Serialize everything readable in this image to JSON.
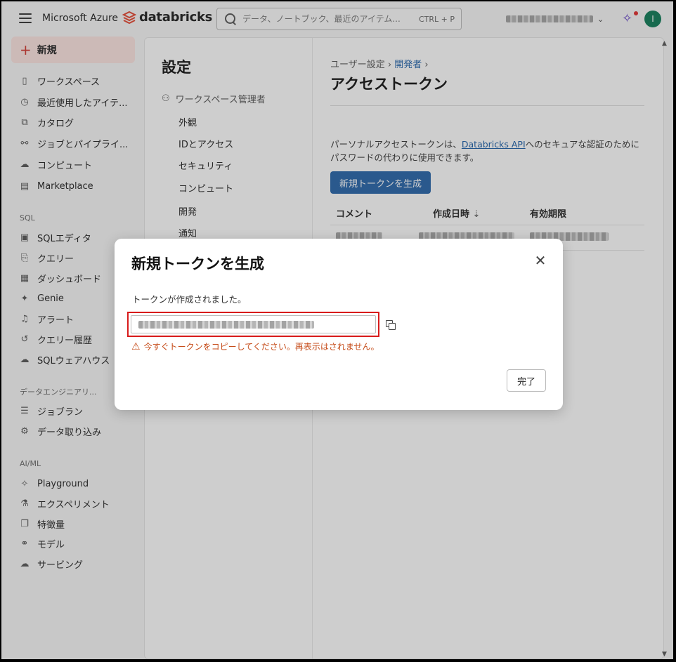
{
  "header": {
    "brand_azure": "Microsoft Azure",
    "brand_databricks": "databricks",
    "search_placeholder": "データ、ノートブック、最近のアイテム...",
    "search_shortcut": "CTRL + P",
    "avatar_initial": "I",
    "accent_color": "#0b7a55"
  },
  "sidebar": {
    "new_label": "新規",
    "items": [
      {
        "icon": "▯",
        "label": "ワークスペース"
      },
      {
        "icon": "◷",
        "label": "最近使用したアイテ..."
      },
      {
        "icon": "⧉",
        "label": "カタログ"
      },
      {
        "icon": "⚯",
        "label": "ジョブとパイプライ..."
      },
      {
        "icon": "☁",
        "label": "コンピュート"
      },
      {
        "icon": "▤",
        "label": "Marketplace"
      }
    ],
    "sql_label": "SQL",
    "sql_items": [
      {
        "icon": "▣",
        "label": "SQLエディタ"
      },
      {
        "icon": "⎘",
        "label": "クエリー"
      },
      {
        "icon": "▦",
        "label": "ダッシュボード"
      },
      {
        "icon": "✦",
        "label": "Genie"
      },
      {
        "icon": "♫",
        "label": "アラート"
      },
      {
        "icon": "↺",
        "label": "クエリー履歴"
      },
      {
        "icon": "☁",
        "label": "SQLウェアハウス"
      }
    ],
    "de_label": "データエンジニアリ...",
    "de_items": [
      {
        "icon": "☰",
        "label": "ジョブラン"
      },
      {
        "icon": "⚙",
        "label": "データ取り込み"
      }
    ],
    "aiml_label": "AI/ML",
    "aiml_items": [
      {
        "icon": "✧",
        "label": "Playground"
      },
      {
        "icon": "⚗",
        "label": "エクスペリメント"
      },
      {
        "icon": "❐",
        "label": "特徴量"
      },
      {
        "icon": "⚭",
        "label": "モデル"
      },
      {
        "icon": "☁",
        "label": "サービング"
      }
    ]
  },
  "settings": {
    "title": "設定",
    "ws_admin": "ワークスペース管理者",
    "items": [
      "外観",
      "IDとアクセス",
      "セキュリティ",
      "コンピュート",
      "開発",
      "通知"
    ]
  },
  "content": {
    "crumb_user": "ユーザー設定",
    "crumb_dev": "開発者",
    "title": "アクセストークン",
    "desc_pre": "パーソナルアクセストークンは、",
    "desc_link": "Databricks API",
    "desc_post": "へのセキュアな認証のためにパスワードの代わりに使用できます。",
    "gen_button": "新規トークンを生成",
    "col_comment": "コメント",
    "col_created": "作成日時",
    "col_expiry": "有効期限"
  },
  "modal": {
    "title": "新規トークンを生成",
    "created_msg": "トークンが作成されました。",
    "warning": "今すぐトークンをコピーしてください。再表示はされません。",
    "done": "完了",
    "warning_color": "#c54a17"
  }
}
